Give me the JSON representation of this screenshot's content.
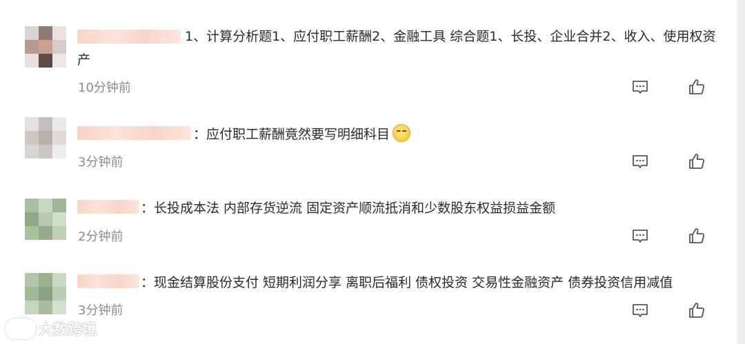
{
  "comments": [
    {
      "text": "1、计算分析题1、应付职工薪酬2、金融工具 综合题1、长投、企业合并2、收入、使用权资产",
      "time": "10分钟前",
      "reply_icon": "comment-icon",
      "like_icon": "thumbs-up-icon"
    },
    {
      "text": "：应付职工薪酬竟然要写明细科目",
      "emoji": "thinking-face-emoji",
      "time": "3分钟前",
      "reply_icon": "comment-icon",
      "like_icon": "thumbs-up-icon"
    },
    {
      "text": "：长投成本法 内部存货逆流 固定资产顺流抵消和少数股东权益损益金额",
      "time": "2分钟前",
      "reply_icon": "comment-icon",
      "like_icon": "thumbs-up-icon"
    },
    {
      "text": "：现金结算股份支付 短期利润分享 离职后福利 债权投资 交易性金融资产 债券投资信用减值",
      "time": "3分钟前",
      "reply_icon": "comment-icon",
      "like_icon": "thumbs-up-icon"
    }
  ],
  "watermark": {
    "text": "大数跨境"
  },
  "colors": {
    "time": "#8c8c8c",
    "text": "#2a2a2a",
    "name_blur": "#f9cdbf"
  }
}
